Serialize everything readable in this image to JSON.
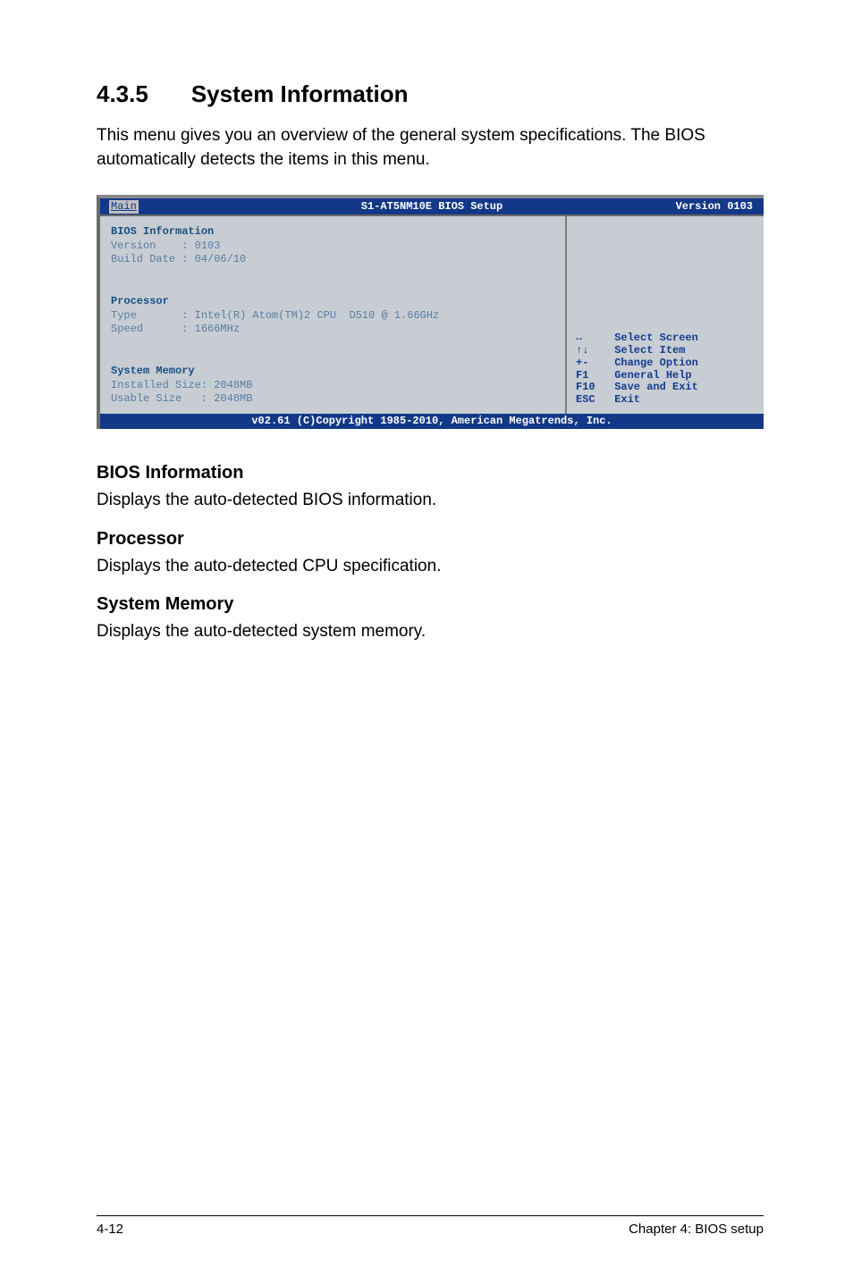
{
  "section": {
    "number": "4.3.5",
    "title": "System Information"
  },
  "intro": "This menu gives you an overview of the general system specifications. The BIOS automatically detects the items in this menu.",
  "bios": {
    "tab": "Main",
    "title_center": "S1-AT5NM10E BIOS Setup",
    "version_label": "Version 0103",
    "heading_bios": "BIOS Information",
    "version_line": "Version    : 0103",
    "builddate_line": "Build Date : 04/06/10",
    "heading_proc": "Processor",
    "proc_type_line": "Type       : Intel(R) Atom(TM)2 CPU  D510 @ 1.66GHz",
    "proc_speed_line": "Speed      : 1666MHz",
    "heading_mem": "System Memory",
    "mem_installed_line": "Installed Size: 2048MB",
    "mem_usable_line": "Usable Size   : 2048MB",
    "hints": "↔     Select Screen\n↑↓    Select Item\n+-    Change Option\nF1    General Help\nF10   Save and Exit\nESC   Exit",
    "footer": "v02.61 (C)Copyright 1985-2010, American Megatrends, Inc."
  },
  "descriptions": [
    {
      "heading": "BIOS Information",
      "text": "Displays the auto-detected BIOS information."
    },
    {
      "heading": "Processor",
      "text": "Displays the auto-detected CPU specification."
    },
    {
      "heading": "System Memory",
      "text": "Displays the auto-detected system memory."
    }
  ],
  "page_footer": {
    "left": "4-12",
    "right": "Chapter 4: BIOS setup"
  }
}
